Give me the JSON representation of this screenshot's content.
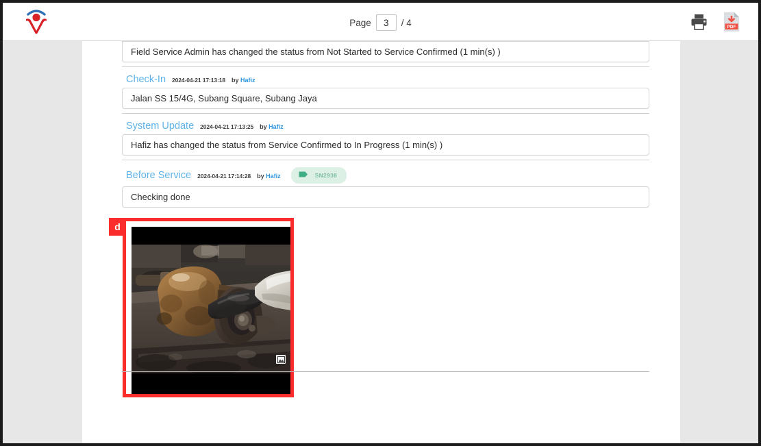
{
  "window": {
    "frame_color": "#1b1b1b",
    "viewer_background": "#e7e7e7",
    "page_background": "#ffffff"
  },
  "toolbar": {
    "logo_name": "company-logo",
    "logo_colors": {
      "mark": "#d92128",
      "arc": "#2f6fb5"
    },
    "pager": {
      "label": "Page",
      "current_page": "3",
      "separator": "/ 4",
      "total_pages": "4"
    },
    "actions": [
      {
        "name": "print-button",
        "icon": "printer-icon",
        "color": "#4a4a4a"
      },
      {
        "name": "download-pdf-button",
        "icon": "pdf-download-icon",
        "color": "#ef5244"
      }
    ]
  },
  "document": {
    "entries": [
      {
        "kind": "continuation",
        "body": "Field Service Admin has changed the status from Not Started to Service Confirmed (1 min(s) )"
      },
      {
        "kind": "entry",
        "title": "Check-In",
        "timestamp": "2024-04-21 17:13:18",
        "by_label": "by",
        "author": "Hafiz",
        "body": "Jalan SS 15/4G, Subang Square, Subang Jaya"
      },
      {
        "kind": "entry",
        "title": "System Update",
        "timestamp": "2024-04-21 17:13:25",
        "by_label": "by",
        "author": "Hafiz",
        "body": "Hafiz has changed the status from Service Confirmed to In Progress (1 min(s) )"
      },
      {
        "kind": "entry",
        "title": "Before Service",
        "timestamp": "2024-04-21 17:14:28",
        "by_label": "by",
        "author": "Hafiz",
        "tag": "SN2938",
        "tag_icon": "tag-icon",
        "body": "Checking done"
      }
    ],
    "attachment": {
      "annotation_letter": "d",
      "annotation_color": "#fb2c2c",
      "photo_alt": "rusty mechanical pump impeller on workbench with gloved hand",
      "photo_badge_icon": "image-thumbnail-icon"
    }
  },
  "colors": {
    "entry_title": "#5cb3e8",
    "author_link": "#2f97e0",
    "tag_background": "#ddf0e6",
    "tag_text": "#7fbfa2",
    "tag_icon": "#3fae86",
    "annotation": "#fb2c2c"
  }
}
